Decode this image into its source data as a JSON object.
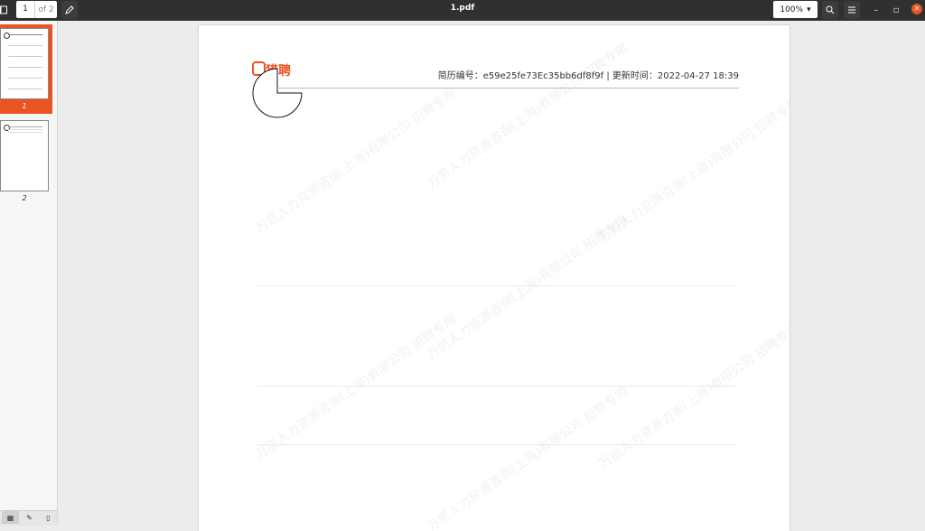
{
  "toolbar": {
    "current_page": "1",
    "total_pages": "of 2",
    "document_title": "1.pdf",
    "zoom_level": "100%"
  },
  "sidebar": {
    "thumbnails": [
      {
        "label": "1",
        "selected": true
      },
      {
        "label": "2",
        "selected": false
      }
    ]
  },
  "page": {
    "logo_text": "猎聘",
    "resume_info": "简历编号：e59e25fe73Ec35bb6df8f9f  |  更新时间：2022-04-27 18:39",
    "watermark_text": "万凯人力资源咨询(上海)有限公司 招聘专用"
  },
  "colors": {
    "accent": "#e95420",
    "topbar": "#303030"
  }
}
